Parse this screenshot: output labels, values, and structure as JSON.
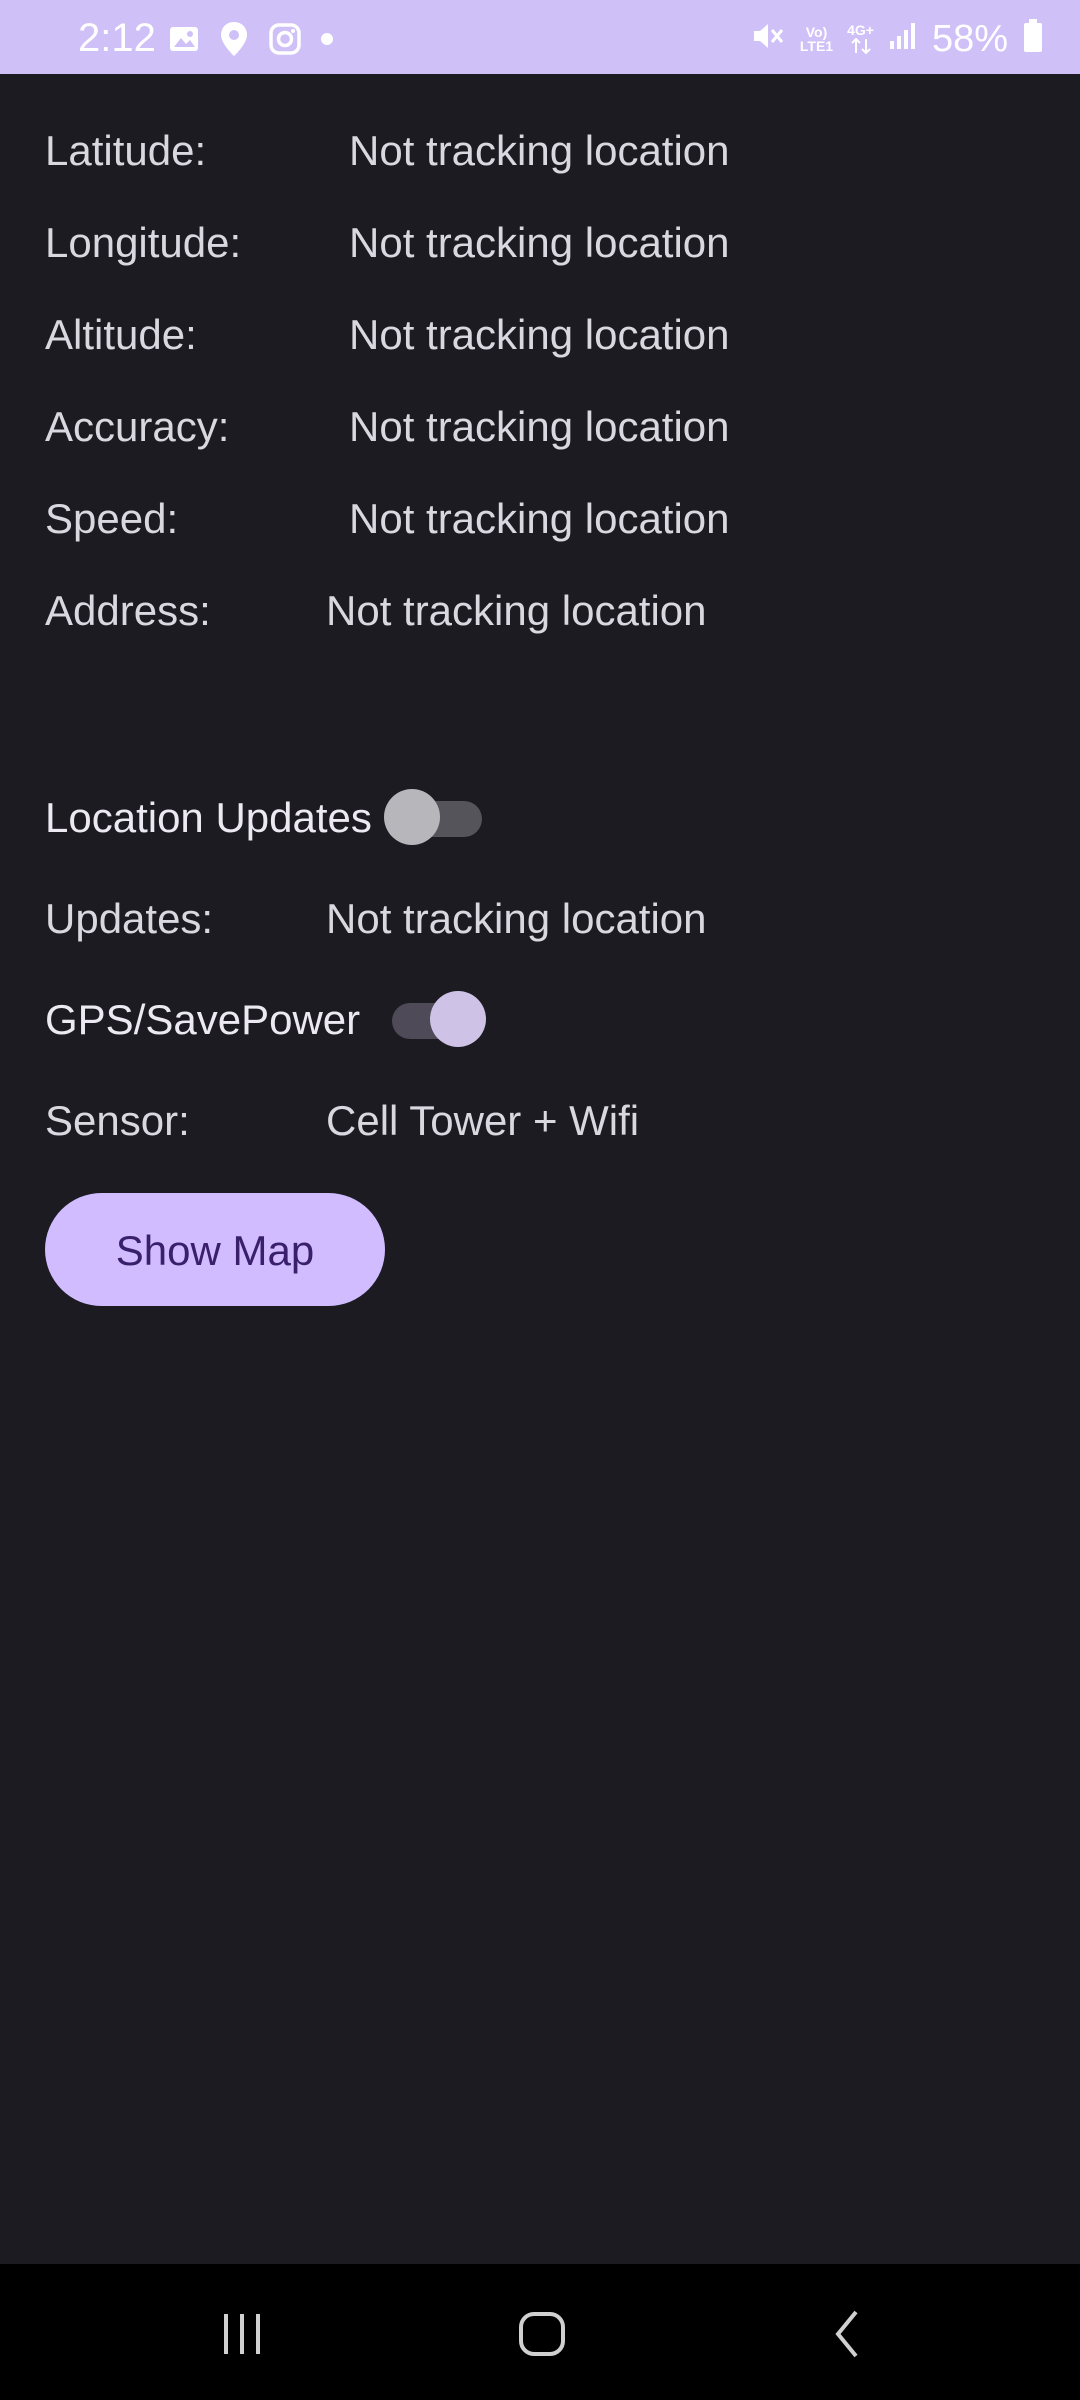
{
  "status_bar": {
    "time": "2:12",
    "battery_percent": "58%",
    "network_label_top": "Vo)",
    "network_label_bottom": "LTE1",
    "network_type": "4G+",
    "icons_left": [
      "gallery-icon",
      "maps-pin-icon",
      "instagram-icon",
      "dot-icon"
    ],
    "icons_right": [
      "mute-icon",
      "volte-icon",
      "data-arrows-icon",
      "signal-icon",
      "battery-icon"
    ]
  },
  "location": {
    "latitude_label": "Latitude:",
    "latitude_value": "Not tracking location",
    "longitude_label": "Longitude:",
    "longitude_value": "Not tracking location",
    "altitude_label": "Altitude:",
    "altitude_value": "Not tracking location",
    "accuracy_label": "Accuracy:",
    "accuracy_value": "Not tracking location",
    "speed_label": "Speed:",
    "speed_value": "Not tracking location",
    "address_label": "Address:",
    "address_value": "Not tracking location"
  },
  "settings": {
    "location_updates_label": "Location Updates",
    "location_updates_on": false,
    "updates_label": "Updates:",
    "updates_value": "Not tracking location",
    "gps_savepower_label": "GPS/SavePower",
    "gps_savepower_on": true,
    "sensor_label": "Sensor:",
    "sensor_value": "Cell Tower + Wifi"
  },
  "actions": {
    "show_map_label": "Show Map"
  },
  "colors": {
    "status_bar": "#cfc0f7",
    "background": "#1c1b22",
    "accent": "#d0bcff",
    "button_text": "#3a1f6b"
  },
  "nav_bar": {
    "items": [
      "recents-icon",
      "home-icon",
      "back-icon"
    ]
  }
}
